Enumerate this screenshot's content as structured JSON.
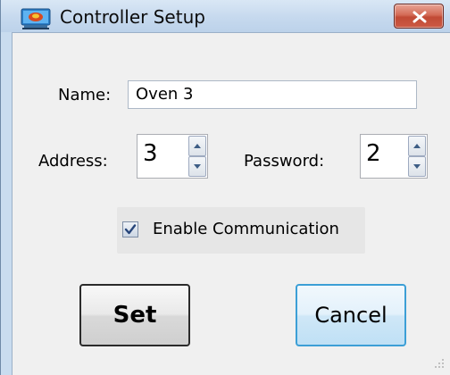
{
  "window": {
    "title": "Controller Setup"
  },
  "form": {
    "name_label": "Name:",
    "name_value": "Oven 3",
    "address_label": "Address:",
    "address_value": "3",
    "password_label": "Password:",
    "password_value": "2",
    "enable_label": "Enable Communication",
    "enable_checked": true
  },
  "buttons": {
    "set_label": "Set",
    "cancel_label": "Cancel"
  },
  "icons": {
    "app": "controller-app-icon",
    "close": "close-icon",
    "spin_up": "arrow-up-icon",
    "spin_down": "arrow-down-icon",
    "check": "checkmark-icon",
    "grip": "resize-grip-icon"
  },
  "colors": {
    "titlebar": "#c6d9ee",
    "close_button": "#c14a35",
    "default_button_focus": "#3c9fd6",
    "dialog_bg": "#f0f0f0"
  }
}
